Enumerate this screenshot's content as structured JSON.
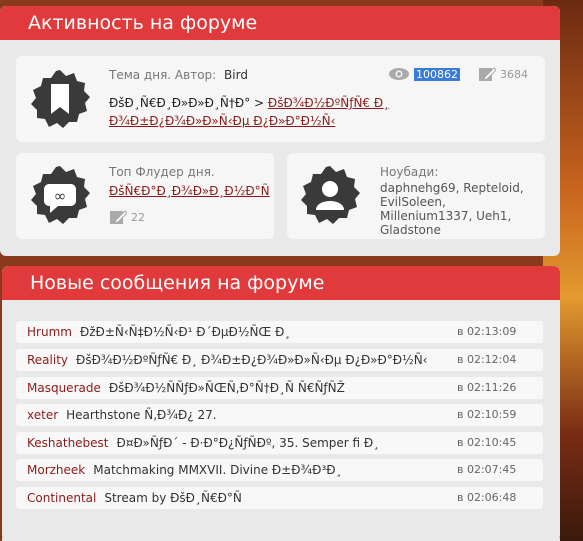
{
  "activity": {
    "heading": "Активность на форуме",
    "topic_of_day": {
      "label": "Тема дня. Автор:",
      "author": "Bird",
      "views": "100862",
      "posts": "3684",
      "text": "ÐšÐ¸Ñ€Ð¸Ð»Ð»Ð¸Ñ†Ð° > ",
      "link_text_1": "ÐšÐ¾Ð½ÐºÑƒÑ€ Ð¸",
      "link_text_2": "Ð¾Ð±Ð¿Ð¾Ð»Ð»Ñ‹Ðµ Ð¿Ð»Ð°Ð½Ñ‹"
    },
    "top_flooder": {
      "label": "Топ Флудер дня.",
      "name": "ÐšÑ€Ð°Ð¸Ð¾Ð»Ð¸Ð½Ð°Ñ",
      "posts": "22"
    },
    "noobs": {
      "label": "Ноубади:",
      "names": "daphnehg69, Repteloid, EvilSoleen, Millenium1337, Ueh1, Gladstone"
    }
  },
  "new_posts": {
    "heading": "Новые сообщения на форуме",
    "rows": [
      {
        "author": "Hrumm",
        "title": "ÐžÐ±Ñ‹Ñ‡Ð½Ñ‹Ð¹ Ð´ÐµÐ½ÑŒ Ð¸",
        "time": "в 02:13:09"
      },
      {
        "author": "Reality",
        "title": "ÐšÐ¾Ð½ÐºÑƒÑ€ Ð¸ Ð¾Ð±Ð¿Ð¾Ð»Ð»Ñ‹Ðµ Ð¿Ð»Ð°Ð½Ñ‹",
        "time": "в 02:12:04"
      },
      {
        "author": "Masquerade",
        "title": "ÐšÐ¾Ð½ÑÑƒÐ»ÑŒÑ‚Ð°Ñ†Ð¸Ñ Ñ€ÑƒÑŽ",
        "time": "в 02:11:26"
      },
      {
        "author": "xeter",
        "title": "Hearthstone Ñ‚Ð¾Ð¿ 27.",
        "time": "в 02:10:59"
      },
      {
        "author": "Keshathebest",
        "title": "Ð¤Ð»ÑƒÐ´ - Ð·Ð°Ð¿ÑƒÑÐº, 35. Semper fi Ð¸",
        "time": "в 02:10:45"
      },
      {
        "author": "Morzheek",
        "title": "Matchmaking MMXVII. Divine Ð±Ð¾Ð³Ð¸",
        "time": "в 02:07:45"
      },
      {
        "author": "Continental",
        "title": "Stream by ÐšÐ¸Ñ€Ð°Ñ",
        "time": "в 02:06:48"
      }
    ]
  }
}
